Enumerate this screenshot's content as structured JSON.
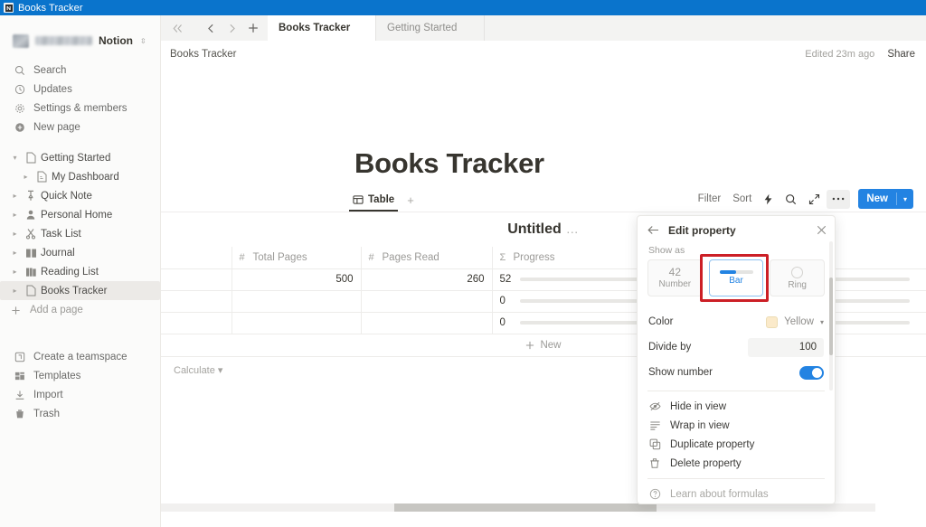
{
  "window": {
    "title": "Books Tracker",
    "icon": "notion-app-icon",
    "titlebar_color": "#0a74cc"
  },
  "tabstrip": {
    "nav": {
      "back": "back-arrow",
      "forward": "forward-arrow",
      "new_tab": "plus",
      "collapse": "double-chevron-left"
    },
    "tabs": [
      {
        "label": "Books Tracker",
        "active": true
      },
      {
        "label": "Getting Started",
        "active": false
      }
    ]
  },
  "sidebar": {
    "workspace": {
      "name": "Notion",
      "name_redacted": true,
      "caret": "chevron-updown"
    },
    "actions": [
      {
        "label": "Search",
        "icon": "search-icon"
      },
      {
        "label": "Updates",
        "icon": "clock-icon"
      },
      {
        "label": "Settings & members",
        "icon": "gear-icon"
      },
      {
        "label": "New page",
        "icon": "plus-circle-icon"
      }
    ],
    "pages": [
      {
        "label": "Getting Started",
        "icon": "page-icon",
        "level": 0,
        "expanded": true,
        "selected": false
      },
      {
        "label": "My Dashboard",
        "icon": "page-icon",
        "level": 1,
        "expanded": false,
        "selected": false
      },
      {
        "label": "Quick Note",
        "icon": "pin-icon",
        "level": 0,
        "expanded": false,
        "selected": false
      },
      {
        "label": "Personal Home",
        "icon": "person-icon",
        "level": 0,
        "expanded": false,
        "selected": false
      },
      {
        "label": "Task List",
        "icon": "scissors-icon",
        "level": 0,
        "expanded": false,
        "selected": false
      },
      {
        "label": "Journal",
        "icon": "book-icon",
        "level": 0,
        "expanded": false,
        "selected": false
      },
      {
        "label": "Reading List",
        "icon": "books-icon",
        "level": 0,
        "expanded": false,
        "selected": false
      },
      {
        "label": "Books Tracker",
        "icon": "page-icon",
        "level": 0,
        "expanded": false,
        "selected": true
      }
    ],
    "add_page": {
      "label": "Add a page",
      "icon": "plus-icon"
    },
    "bottom": [
      {
        "label": "Create a teamspace",
        "icon": "teamspace-icon"
      },
      {
        "label": "Templates",
        "icon": "templates-icon"
      },
      {
        "label": "Import",
        "icon": "import-icon"
      },
      {
        "label": "Trash",
        "icon": "trash-icon"
      }
    ]
  },
  "header": {
    "breadcrumb": "Books Tracker",
    "edited": "Edited 23m ago",
    "share": "Share"
  },
  "page": {
    "title": "Books Tracker"
  },
  "view": {
    "tab_label": "Table",
    "tab_icon": "table-icon",
    "add_view": "+",
    "toolbar": {
      "filter": "Filter",
      "sort": "Sort",
      "automation_icon": "lightning-icon",
      "search_icon": "search-icon",
      "expand_icon": "expand-icon",
      "more_icon": "ellipsis-icon",
      "new_label": "New",
      "new_caret": "chevron-down-icon",
      "new_color": "#2383e2"
    }
  },
  "database": {
    "title": "Untitled",
    "title_menu": "…",
    "columns": [
      {
        "label": "",
        "symbol": ""
      },
      {
        "label": "Total Pages",
        "symbol": "#"
      },
      {
        "label": "Pages Read",
        "symbol": "#"
      },
      {
        "label": "Progress",
        "symbol": "Σ"
      }
    ],
    "rows": [
      {
        "name": "",
        "total_pages": "500",
        "pages_read": "260",
        "progress_value": "52",
        "progress_pct": 52
      },
      {
        "name": "",
        "total_pages": "",
        "pages_read": "",
        "progress_value": "0",
        "progress_pct": 0
      },
      {
        "name": "",
        "total_pages": "",
        "pages_read": "",
        "progress_value": "0",
        "progress_pct": 0
      }
    ],
    "progress_bar_color": "#c19a3d",
    "new_row": "New",
    "calculate": "Calculate"
  },
  "edit_property_panel": {
    "title": "Edit property",
    "back_icon": "back-arrow-icon",
    "close_icon": "close-icon",
    "show_as_label": "Show as",
    "show_as_options": [
      {
        "label": "Number",
        "preview": "42",
        "selected": false
      },
      {
        "label": "Bar",
        "preview": "bar-preview",
        "selected": true,
        "highlighted": true
      },
      {
        "label": "Ring",
        "preview": "ring-preview",
        "selected": false
      }
    ],
    "color": {
      "label": "Color",
      "value": "Yellow",
      "swatch": "#fbeaca"
    },
    "divide_by": {
      "label": "Divide by",
      "value": "100"
    },
    "show_number": {
      "label": "Show number",
      "enabled": true
    },
    "menu": [
      {
        "label": "Hide in view",
        "icon": "eye-off-icon"
      },
      {
        "label": "Wrap in view",
        "icon": "wrap-icon"
      },
      {
        "label": "Duplicate property",
        "icon": "duplicate-icon"
      },
      {
        "label": "Delete property",
        "icon": "trash-icon"
      }
    ],
    "footer": {
      "label": "Learn about formulas",
      "icon": "question-icon"
    },
    "highlight_color": "#cc1f26"
  }
}
